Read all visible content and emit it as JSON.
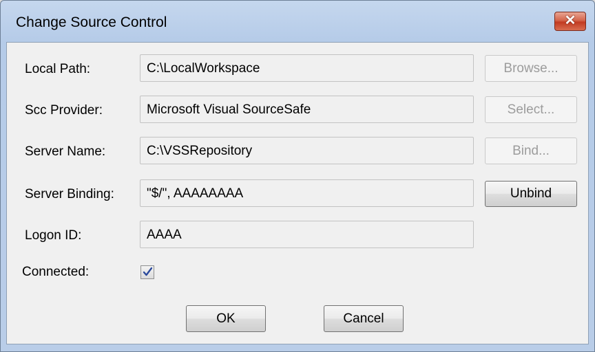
{
  "window": {
    "title": "Change Source Control",
    "close_glyph": "✕"
  },
  "fields": {
    "local_path": {
      "label": "Local Path:",
      "value": "C:\\LocalWorkspace"
    },
    "scc_provider": {
      "label": "Scc Provider:",
      "value": "Microsoft Visual SourceSafe"
    },
    "server_name": {
      "label": "Server Name:",
      "value": "C:\\VSSRepository"
    },
    "server_binding": {
      "label": "Server Binding:",
      "value": "\"$/\", AAAAAAAA"
    },
    "logon_id": {
      "label": "Logon ID:",
      "value": "AAAA"
    }
  },
  "connected": {
    "label": "Connected:",
    "checked": true
  },
  "buttons": {
    "browse": "Browse...",
    "select": "Select...",
    "bind": "Bind...",
    "unbind": "Unbind",
    "ok": "OK",
    "cancel": "Cancel"
  },
  "icons": {
    "close": "close-icon",
    "check": "checkmark-icon"
  },
  "colors": {
    "close_button": "#c94b2e",
    "titlebar": "#c5d7ee",
    "checkmark": "#2b4a9c"
  }
}
